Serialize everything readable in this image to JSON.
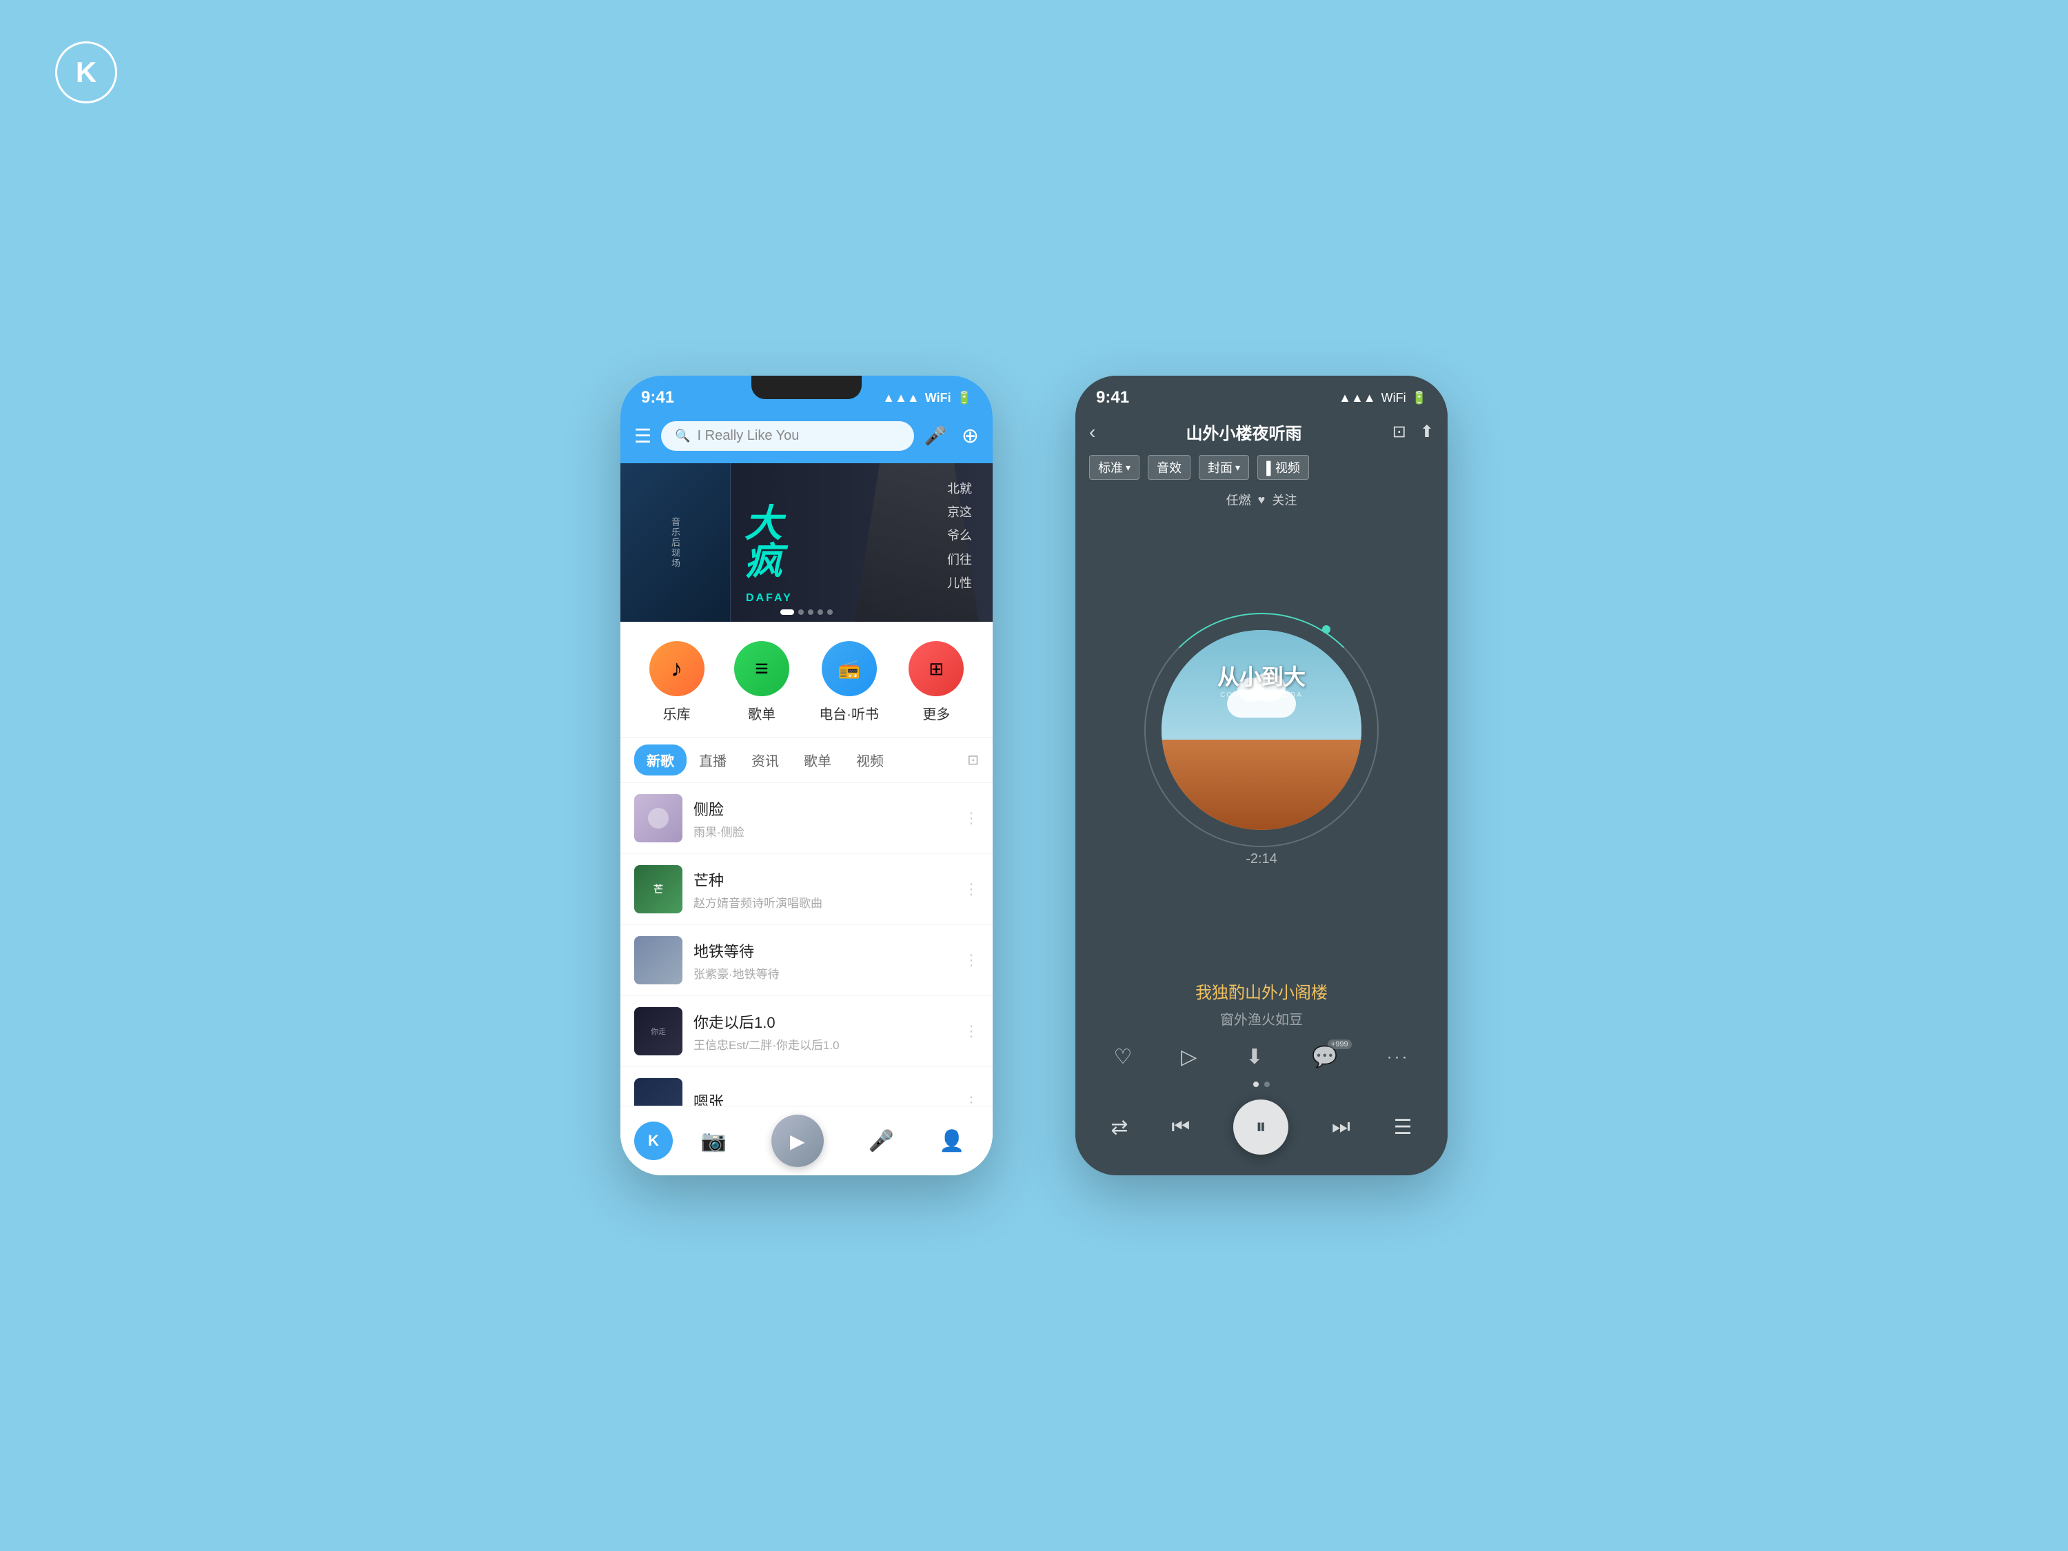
{
  "app": {
    "logo": "K",
    "bg_color": "#87CEEB"
  },
  "left_phone": {
    "status_bar": {
      "time": "9:41",
      "signal": "▲▲▲",
      "wifi": "WiFi",
      "battery": "Battery"
    },
    "header": {
      "search_placeholder": "I Really Like You",
      "menu_icon": "☰",
      "mic_icon": "🎤",
      "add_icon": "+"
    },
    "banner": {
      "artist": "DAFAY",
      "subtitle": "音乐后现场",
      "cn_text_1": "北就",
      "cn_text_2": "京这",
      "cn_text_3": "爷么",
      "cn_text_4": "们往",
      "cn_text_5": "儿性",
      "dots": [
        "active",
        "",
        "",
        "",
        ""
      ]
    },
    "quick_access": [
      {
        "label": "乐库",
        "icon": "♪",
        "color": "orange"
      },
      {
        "label": "歌单",
        "icon": "≡",
        "color": "green"
      },
      {
        "label": "电台·听书",
        "icon": "📻",
        "color": "blue"
      },
      {
        "label": "更多",
        "icon": "⊞",
        "color": "red"
      }
    ],
    "tabs": [
      {
        "label": "新歌",
        "active": true
      },
      {
        "label": "直播",
        "active": false
      },
      {
        "label": "资讯",
        "active": false
      },
      {
        "label": "歌单",
        "active": false
      },
      {
        "label": "视频",
        "active": false
      }
    ],
    "songs": [
      {
        "title": "侧脸",
        "subtitle": "雨果-侧脸",
        "thumb_type": "1"
      },
      {
        "title": "芒种",
        "subtitle": "赵方婧音频诗听演唱歌曲",
        "thumb_type": "2"
      },
      {
        "title": "地铁等待",
        "subtitle": "张紫豪-地铁等待",
        "thumb_type": "3"
      },
      {
        "title": "你走以后1.0",
        "subtitle": "王信忠Est/二胖-你走以后1.0",
        "thumb_type": "4"
      },
      {
        "title": "嗯张",
        "subtitle": "",
        "thumb_type": "5"
      }
    ],
    "player_bar": {
      "k_label": "K"
    }
  },
  "right_phone": {
    "status_bar": {
      "time": "9:41"
    },
    "nav": {
      "back": "‹",
      "title": "山外小楼夜听雨",
      "airplay_icon": "⊡",
      "share_icon": "⬆"
    },
    "quality_tags": [
      {
        "label": "标准",
        "has_arrow": true
      },
      {
        "label": "音效"
      },
      {
        "label": "封面",
        "has_arrow": true
      },
      {
        "label": "▌视频"
      }
    ],
    "follow": {
      "author": "任燃",
      "follow_text": "关注",
      "heart_icon": "♥"
    },
    "album": {
      "title_cn": "从小到大",
      "subtitle_pinyin": "CONGXIAO DADDA",
      "time_remaining": "-2:14"
    },
    "lyrics": [
      {
        "text": "我独酌山外小阁楼",
        "active": true
      },
      {
        "text": "窗外渔火如豆",
        "active": false
      }
    ],
    "actions": [
      {
        "icon": "♡",
        "label": "like"
      },
      {
        "icon": "▷",
        "label": "mv",
        "badge": ""
      },
      {
        "icon": "⬇",
        "label": "download",
        "badge": ""
      },
      {
        "icon": "💬",
        "label": "comment",
        "badge": "+999"
      },
      {
        "icon": "···",
        "label": "more"
      }
    ],
    "progress_dots": [
      "active",
      ""
    ],
    "controls": {
      "shuffle": "⇄",
      "prev": "⏮",
      "play_pause": "⏸",
      "next": "⏭",
      "playlist": "☰"
    }
  }
}
